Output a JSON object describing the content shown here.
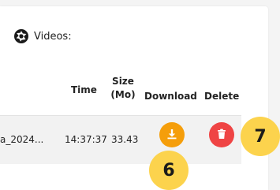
{
  "section": {
    "title": "Videos:",
    "icon": "camera-aperture-icon"
  },
  "table": {
    "headers": {
      "time": "Time",
      "size_line1": "Size",
      "size_line2": "(Mo)",
      "download": "Download",
      "delete": "Delete"
    },
    "rows": [
      {
        "name": "a_2024...",
        "time": "14:37:37",
        "size": "33.43",
        "download_icon": "download-icon",
        "delete_icon": "trash-icon"
      }
    ]
  },
  "badges": {
    "download": "6",
    "delete": "7"
  },
  "colors": {
    "download_button": "#f59e0b",
    "delete_button": "#ef4444",
    "badge": "#fcd34d"
  }
}
